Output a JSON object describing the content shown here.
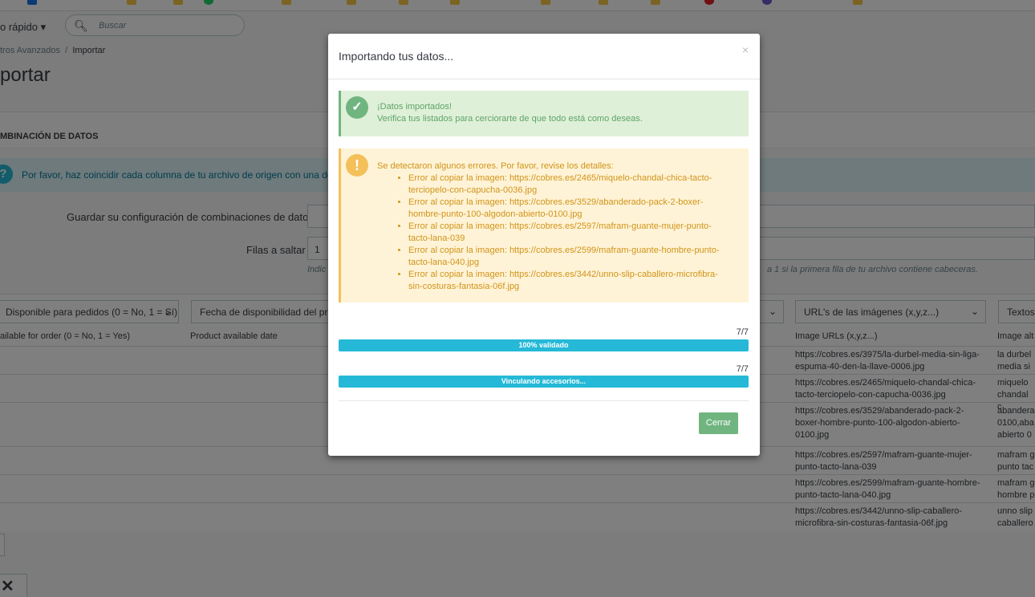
{
  "background": {
    "quick_access": "o rápido",
    "search_placeholder": "Buscar",
    "breadcrumb_parent": "tros Avanzados",
    "breadcrumb_sep": "/",
    "breadcrumb_current": "Importar",
    "page_title": "portar",
    "panel_heading": "MBINACIÓN DE DATOS",
    "info_text": "Por favor, haz coincidir cada columna de tu archivo de origen con una de las",
    "save_config_label": "Guardar su configuración de combinaciones de datos",
    "skip_rows_label": "Filas a saltar",
    "skip_rows_value": "1",
    "hint_left": "Indic",
    "hint_right": "a 1 si la primera fila de tu archivo contiene cabeceras.",
    "selects": {
      "available_orders": "Disponible para pedidos (0 = No, 1 = Sí)",
      "available_date": "Fecha de disponibilidad del prod",
      "image_urls": "URL's de las imágenes (x,y,z...)",
      "texts": "Textos"
    },
    "column_headers": {
      "available_orders": "ailable for order (0 = No, 1 = Yes)",
      "available_date": "Product available date",
      "image_urls": "Image URLs (x,y,z...)",
      "image_alt": "Image alt"
    },
    "rows": [
      {
        "url": "https://cobres.es/3975/la-durbel-media-sin-liga-espuma-40-den-la-llave-0006.jpg",
        "alt": "la durbel media si"
      },
      {
        "url": "https://cobres.es/2465/miquelo-chandal-chica-tacto-terciopelo-con-capucha-0036.jpg",
        "alt": "miquelo chandal c"
      },
      {
        "url": "https://cobres.es/3529/abanderado-pack-2-boxer-hombre-punto-100-algodon-abierto-0100.jpg",
        "alt": "abandera 0100,aba abierto 0"
      },
      {
        "url": "https://cobres.es/2597/mafram-guante-mujer-punto-tacto-lana-039",
        "alt": "mafram g punto tac"
      },
      {
        "url": "https://cobres.es/2599/mafram-guante-hombre-punto-tacto-lana-040.jpg",
        "alt": "mafram g hombre p"
      },
      {
        "url": "https://cobres.es/3442/unno-slip-caballero-microfibra-sin-costuras-fantasia-06f.jpg",
        "alt": "unno slip caballero"
      }
    ]
  },
  "modal": {
    "title": "Importando tus datos...",
    "close_symbol": "×",
    "success": {
      "line1": "¡Datos importados!",
      "line2": "Verifica tus listados para cerciorarte de que todo está como deseas."
    },
    "warning": {
      "heading": "Se detectaron algunos errores. Por favor, revise los detalles:",
      "errors": [
        "Error al copiar la imagen: https://cobres.es/2465/miquelo-chandal-chica-tacto-terciopelo-con-capucha-0036.jpg",
        "Error al copiar la imagen: https://cobres.es/3529/abanderado-pack-2-boxer-hombre-punto-100-algodon-abierto-0100.jpg",
        "Error al copiar la imagen: https://cobres.es/2597/mafram-guante-mujer-punto-tacto-lana-039",
        "Error al copiar la imagen: https://cobres.es/2599/mafram-guante-hombre-punto-tacto-lana-040.jpg",
        "Error al copiar la imagen: https://cobres.es/3442/unno-slip-caballero-microfibra-sin-costuras-fantasia-06f.jpg"
      ]
    },
    "progress1": {
      "count": "7/7",
      "label": "100% validado",
      "fraction": 1.0
    },
    "progress2": {
      "count": "7/7",
      "label": "Vinculando accesorios...",
      "fraction": 1.0
    },
    "close_button": "Cerrar"
  },
  "colors": {
    "accent": "#25b9d7",
    "success": "#70b580",
    "warning": "#f4c05a"
  }
}
